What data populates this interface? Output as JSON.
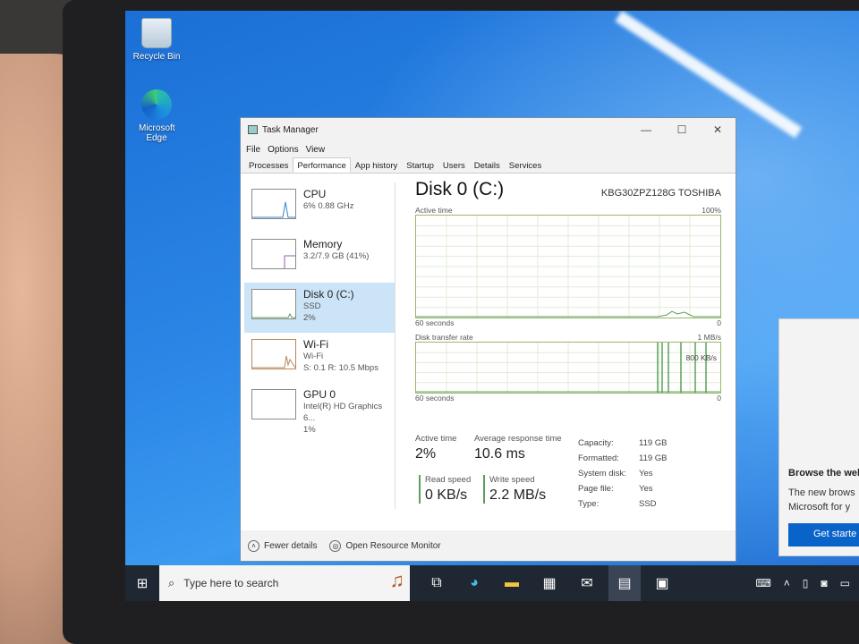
{
  "desktop": {
    "icons": [
      {
        "label": "Recycle Bin"
      },
      {
        "label": "Microsoft Edge"
      }
    ]
  },
  "promo": {
    "title": "Browse the wel",
    "text_line1": "The new brows",
    "text_line2": "Microsoft for y",
    "button": "Get starte"
  },
  "window": {
    "title": "Task Manager",
    "controls": {
      "minimize": "—",
      "maximize": "☐",
      "close": "✕"
    },
    "menu": [
      "File",
      "Options",
      "View"
    ],
    "tabs": [
      "Processes",
      "Performance",
      "App history",
      "Startup",
      "Users",
      "Details",
      "Services"
    ],
    "active_tab": "Performance"
  },
  "sidebar": {
    "items": [
      {
        "name": "CPU",
        "line1": "6% 0.88 GHz",
        "line2": "",
        "line3": ""
      },
      {
        "name": "Memory",
        "line1": "3.2/7.9 GB (41%)",
        "line2": "",
        "line3": ""
      },
      {
        "name": "Disk 0 (C:)",
        "line1": "SSD",
        "line2": "2%",
        "line3": ""
      },
      {
        "name": "Wi-Fi",
        "line1": "Wi-Fi",
        "line2": "S: 0.1  R: 10.5 Mbps",
        "line3": ""
      },
      {
        "name": "GPU 0",
        "line1": "Intel(R) HD Graphics 6...",
        "line2": "1%",
        "line3": ""
      }
    ],
    "active_index": 2
  },
  "disk": {
    "title": "Disk 0 (C:)",
    "model": "KBG30ZPZ128G TOSHIBA",
    "active_time": {
      "label": "Active time",
      "max": "100%",
      "span": "60 seconds",
      "min": "0",
      "peak_percent": 6
    },
    "transfer_rate": {
      "label": "Disk transfer rate",
      "max": "1 MB/s",
      "span": "60 seconds",
      "min": "0",
      "marker": "800 KB/s"
    }
  },
  "stats": {
    "active_time": {
      "label": "Active time",
      "value": "2%"
    },
    "avg_response": {
      "label": "Average response time",
      "value": "10.6 ms"
    },
    "read_speed": {
      "label": "Read speed",
      "value": "0 KB/s"
    },
    "write_speed": {
      "label": "Write speed",
      "value": "2.2 MB/s"
    },
    "props": [
      {
        "key": "Capacity:",
        "value": "119 GB"
      },
      {
        "key": "Formatted:",
        "value": "119 GB"
      },
      {
        "key": "System disk:",
        "value": "Yes"
      },
      {
        "key": "Page file:",
        "value": "Yes"
      },
      {
        "key": "Type:",
        "value": "SSD"
      }
    ]
  },
  "footer": {
    "fewer_details": "Fewer details",
    "resource_monitor": "Open Resource Monitor"
  },
  "taskbar": {
    "search_placeholder": "Type here to search"
  },
  "colors": {
    "accent_blue": "#0a63c9",
    "disk_graph": "#5aa05a",
    "sidebar_active": "#cce4f7"
  }
}
